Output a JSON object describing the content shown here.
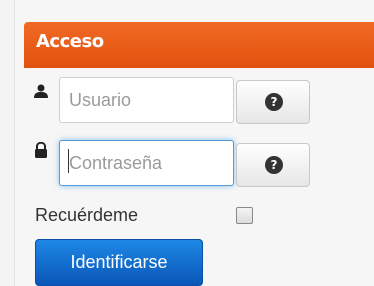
{
  "header": {
    "title": "Acceso"
  },
  "username": {
    "placeholder": "Usuario",
    "icon": "user-icon"
  },
  "password": {
    "placeholder": "Contraseña",
    "icon": "lock-icon"
  },
  "help": {
    "icon": "question-circle-icon"
  },
  "remember": {
    "label": "Recuérdeme",
    "checked": false
  },
  "login": {
    "label": "Identificarse"
  },
  "colors": {
    "header": "#e95a1b",
    "button": "#1565c0",
    "focus": "#5b9bd5"
  }
}
